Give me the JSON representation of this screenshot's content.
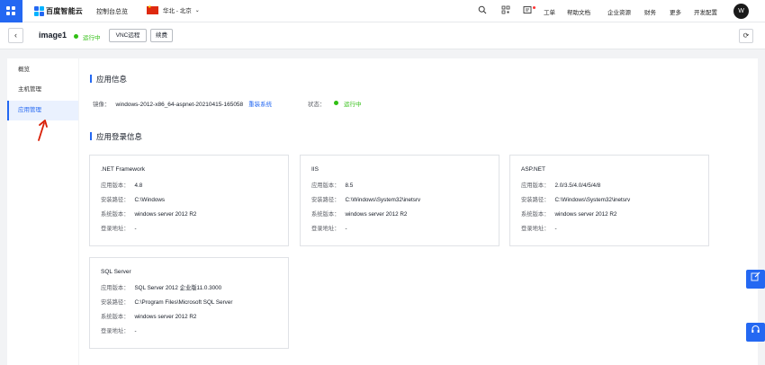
{
  "topbar": {
    "logo_text": "百度智能云",
    "console_label": "控制台总览",
    "region": "华北 - 北京",
    "links": [
      "工单",
      "帮助文档",
      "企业资源",
      "财务",
      "更多",
      "开发配置"
    ],
    "avatar_initial": "W"
  },
  "header": {
    "instance_name": "image1",
    "status": "运行中",
    "vnc_button": "VNC远程",
    "renew_button": "续费"
  },
  "sidebar": {
    "items": [
      {
        "label": "概览"
      },
      {
        "label": "主机管理"
      },
      {
        "label": "应用管理"
      }
    ]
  },
  "main": {
    "app_info_title": "应用信息",
    "image_label": "镜像：",
    "image_value": "windows-2012-x86_64-aspnet-20210415-165058",
    "reinstall_link": "重装系统",
    "state_label": "状态：",
    "state_value": "运行中",
    "login_info_title": "应用登录信息",
    "field_labels": {
      "version": "应用版本：",
      "path": "安装路径：",
      "os": "系统版本：",
      "login": "登录地址："
    },
    "cards": [
      {
        "title": ".NET Framework",
        "version": "4.8",
        "path": "C:\\Windows",
        "os": "windows server 2012 R2",
        "login": "-"
      },
      {
        "title": "IIS",
        "version": "8.5",
        "path": "C:\\Windows\\System32\\inetsrv",
        "os": "windows server 2012 R2",
        "login": "-"
      },
      {
        "title": "ASP.NET",
        "version": "2.0/3.5/4.0/4/5/4/8",
        "path": "C:\\Windows\\System32\\inetsrv",
        "os": "windows server 2012 R2",
        "login": "-"
      },
      {
        "title": "SQL Server",
        "version": "SQL Server 2012 企业版11.0.3000",
        "path": "C:\\Program Files\\Microsoft SQL Server",
        "os": "windows server 2012 R2",
        "login": "-"
      }
    ]
  },
  "colors": {
    "primary": "#2468f2",
    "running": "#30bf13",
    "annotation_arrow": "#d81e06"
  }
}
